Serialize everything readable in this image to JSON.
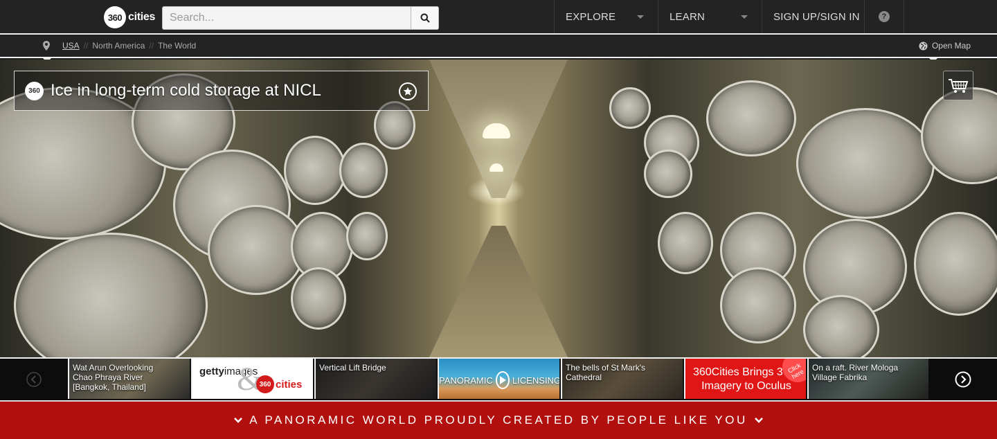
{
  "header": {
    "logo_text": "cities",
    "logo_badge": "360",
    "search_placeholder": "Search...",
    "nav": {
      "explore": "EXPLORE",
      "learn": "LEARN",
      "signup": "SIGN UP/SIGN IN",
      "help": "?"
    }
  },
  "breadcrumb": {
    "items": [
      "USA",
      "North America",
      "The World"
    ],
    "separator": "//",
    "open_map": "Open Map"
  },
  "panorama": {
    "badge": "360",
    "title": "Ice in long-term cold storage at NICL"
  },
  "strip": {
    "items": [
      {
        "label": "Wat Arun Overlooking Chao Phraya River [Bangkok, Thailand]"
      },
      {
        "label_a": "getty",
        "label_b": "images",
        "logo_badge": "360",
        "logo_text": "cities"
      },
      {
        "label": "Vertical Lift Bridge"
      },
      {
        "label_a": "PANORAMIC",
        "label_b": "LICENSING"
      },
      {
        "label": "The bells of St Mark's Cathedral"
      },
      {
        "line1": "360Cities Brings 360°",
        "line2": "Imagery to Oculus",
        "badge": "Click here"
      },
      {
        "label": "On a raft. River Mologa Village Fabrika"
      }
    ]
  },
  "footer": {
    "text": "A PANORAMIC WORLD PROUDLY CREATED BY PEOPLE LIKE YOU"
  },
  "colors": {
    "header_bg": "#232323",
    "footer_red": "#b20f0f",
    "oculus_red": "#e01616"
  }
}
